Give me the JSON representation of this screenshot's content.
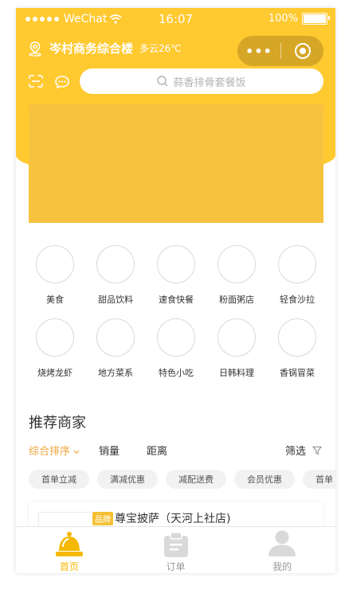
{
  "status_bar": {
    "carrier": "WeChat",
    "time": "16:07",
    "battery": "100%"
  },
  "header": {
    "location": "岑村商务综合楼",
    "weather": "多云26℃",
    "capsule_more": "•••"
  },
  "search": {
    "placeholder": "蒜香排骨套餐饭"
  },
  "categories": [
    "美食",
    "甜品饮料",
    "速食快餐",
    "粉面粥店",
    "轻食沙拉",
    "烧烤龙虾",
    "地方菜系",
    "特色小吃",
    "日韩料理",
    "香锅冒菜"
  ],
  "section": {
    "title": "推荐商家"
  },
  "sort": {
    "comprehensive": "综合排序",
    "sales": "销量",
    "distance": "距离",
    "filter": "筛选"
  },
  "tags": [
    "首单立减",
    "满减优惠",
    "减配送费",
    "会员优惠",
    "首单"
  ],
  "merchant": {
    "badge": "品牌",
    "name": "尊宝披萨（天河上社店)"
  },
  "tabbar": {
    "home": "首页",
    "orders": "订单",
    "mine": "我的"
  },
  "colors": {
    "primary": "#ffc930",
    "accent": "#f0a53e",
    "banner": "#f7c23e"
  }
}
